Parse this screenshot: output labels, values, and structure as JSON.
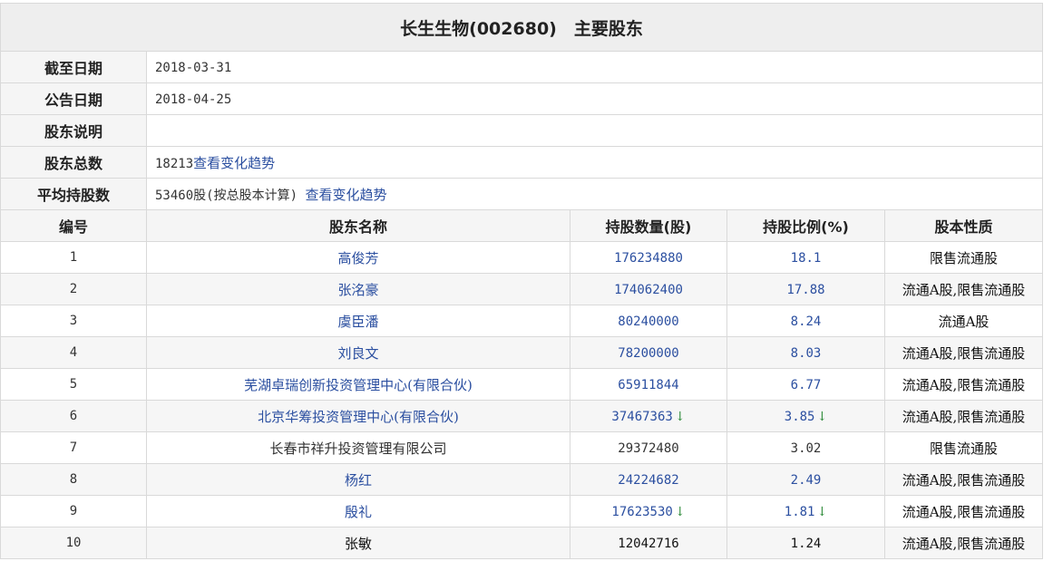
{
  "title": "长生生物(002680)　主要股东",
  "info": [
    {
      "label": "截至日期",
      "value": "2018-03-31"
    },
    {
      "label": "公告日期",
      "value": "2018-04-25"
    },
    {
      "label": "股东说明",
      "value": ""
    },
    {
      "label": "股东总数",
      "value": "18213",
      "link": "查看变化趋势"
    },
    {
      "label": "平均持股数",
      "value": "53460股(按总股本计算) ",
      "link": "查看变化趋势"
    }
  ],
  "columns": [
    "编号",
    "股东名称",
    "持股数量(股)",
    "持股比例(%)",
    "股本性质"
  ],
  "down_arrow": "↓",
  "rows": [
    {
      "no": "1",
      "name": "高俊芳",
      "shares": "176234880",
      "ratio": "18.1",
      "nature": "限售流通股",
      "down": false,
      "link": true
    },
    {
      "no": "2",
      "name": "张洺豪",
      "shares": "174062400",
      "ratio": "17.88",
      "nature": "流通A股,限售流通股",
      "down": false,
      "link": true
    },
    {
      "no": "3",
      "name": "虞臣潘",
      "shares": "80240000",
      "ratio": "8.24",
      "nature": "流通A股",
      "down": false,
      "link": true
    },
    {
      "no": "4",
      "name": "刘良文",
      "shares": "78200000",
      "ratio": "8.03",
      "nature": "流通A股,限售流通股",
      "down": false,
      "link": true
    },
    {
      "no": "5",
      "name": "芜湖卓瑞创新投资管理中心(有限合伙)",
      "shares": "65911844",
      "ratio": "6.77",
      "nature": "流通A股,限售流通股",
      "down": false,
      "link": true
    },
    {
      "no": "6",
      "name": "北京华筹投资管理中心(有限合伙)",
      "shares": "37467363",
      "ratio": "3.85",
      "nature": "流通A股,限售流通股",
      "down": true,
      "link": true
    },
    {
      "no": "7",
      "name": "长春市祥升投资管理有限公司",
      "shares": "29372480",
      "ratio": "3.02",
      "nature": "限售流通股",
      "down": false,
      "link": false
    },
    {
      "no": "8",
      "name": "杨红",
      "shares": "24224682",
      "ratio": "2.49",
      "nature": "流通A股,限售流通股",
      "down": false,
      "link": true
    },
    {
      "no": "9",
      "name": "殷礼",
      "shares": "17623530",
      "ratio": "1.81",
      "nature": "流通A股,限售流通股",
      "down": true,
      "link": true
    },
    {
      "no": "10",
      "name": "张敏",
      "shares": "12042716",
      "ratio": "1.24",
      "nature": "流通A股,限售流通股",
      "down": false,
      "link": false,
      "dark": true
    }
  ]
}
